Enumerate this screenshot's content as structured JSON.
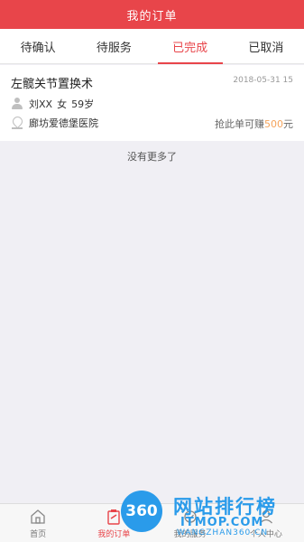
{
  "header": {
    "title": "我的订单"
  },
  "tabs": [
    {
      "label": "待确认",
      "active": false
    },
    {
      "label": "待服务",
      "active": false
    },
    {
      "label": "已完成",
      "active": true
    },
    {
      "label": "已取消",
      "active": false
    }
  ],
  "order": {
    "title": "左髋关节置换术",
    "time": "2018-05-31 15",
    "patient_name": "刘XX",
    "patient_gender": "女",
    "patient_age": "59岁",
    "hospital": "廊坊爱德堡医院",
    "earn_prefix": "抢此单可赚",
    "earn_amount": "500",
    "earn_unit": "元"
  },
  "list_end_text": "没有更多了",
  "tabbar": {
    "items": [
      {
        "label": "首页",
        "icon": "home-icon",
        "active": false
      },
      {
        "label": "我的订单",
        "icon": "clipboard-icon",
        "active": true
      },
      {
        "label": "我的服务",
        "icon": "service-icon",
        "active": false
      },
      {
        "label": "个人中心",
        "icon": "person-icon",
        "active": false
      }
    ]
  },
  "watermark": {
    "circle_text": "360",
    "line1": "网站排行榜",
    "line2": "ITMOP.COM",
    "line3": "WANGZHAN360.CN"
  },
  "colors": {
    "accent": "#e8454a",
    "earn_amount": "#f5a45d",
    "background": "#f0eff4",
    "watermark": "#2a9bea"
  }
}
